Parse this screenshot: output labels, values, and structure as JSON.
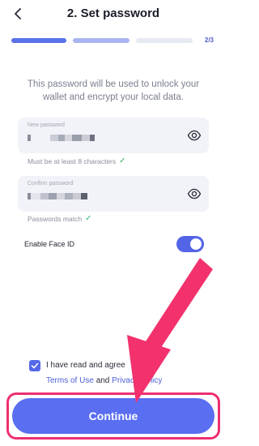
{
  "header": {
    "title": "2. Set password",
    "step": "2/3",
    "back_icon": "chevron-left-icon"
  },
  "progress": {
    "current_step": 2,
    "total_steps": 3,
    "colors": [
      "#5b72e8",
      "#a9b5f0",
      "#e7e9f2"
    ]
  },
  "description": "This password will be used to unlock your wallet and encrypt your local data.",
  "new_password": {
    "label": "New password",
    "hint": "Must be at least 8 characters",
    "hint_icon": "checkmark-icon",
    "toggle_icon": "eye-icon"
  },
  "confirm_password": {
    "label": "Confirm password",
    "hint": "Passwords match",
    "hint_icon": "checkmark-icon",
    "toggle_icon": "eye-icon"
  },
  "face_id": {
    "label": "Enable Face ID",
    "enabled": true
  },
  "agreement": {
    "checked": true,
    "text": "I have read and agree",
    "terms": "Terms of Use",
    "and": "and",
    "privacy": "Privacy Policy"
  },
  "continue_label": "Continue",
  "colors": {
    "accent": "#5a6ef2",
    "highlight": "#ee2f6f",
    "success": "#2fb36a"
  }
}
